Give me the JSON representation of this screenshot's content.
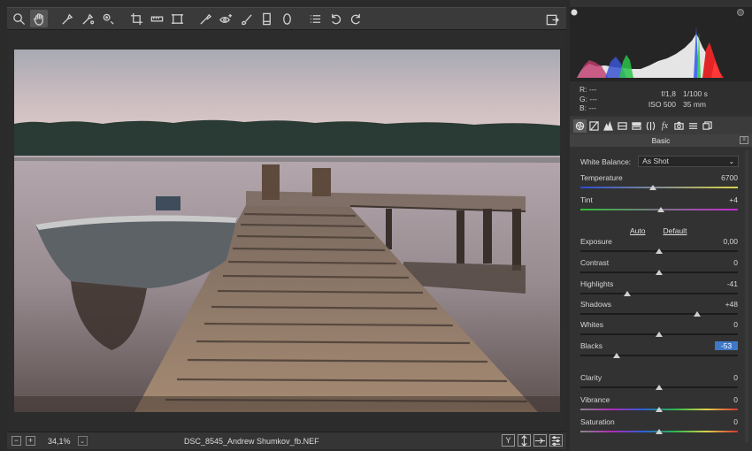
{
  "toolbar": {
    "tools": [
      "zoom-icon",
      "hand-icon",
      "white-balance-icon",
      "color-sampler-icon",
      "target-adjust-icon",
      "crop-icon",
      "straighten-icon",
      "transform-icon",
      "spot-removal-icon",
      "red-eye-icon",
      "adjustment-brush-icon",
      "graduated-filter-icon",
      "radial-filter-icon",
      "presets-list-icon",
      "rotate-ccw-icon",
      "rotate-cw-icon"
    ],
    "active_tool": "hand-icon"
  },
  "status": {
    "zoom": "34,1%",
    "filename": "DSC_8545_Andrew Shumkov_fb.NEF",
    "zoom_minus": "−",
    "zoom_plus": "+",
    "y_label": "Y"
  },
  "readout": {
    "r_label": "R:",
    "r_value": "---",
    "g_label": "G:",
    "g_value": "---",
    "b_label": "B:",
    "b_value": "---",
    "aperture": "f/1,8",
    "shutter": "1/100 s",
    "iso": "ISO 500",
    "focal": "35 mm"
  },
  "panel": {
    "title": "Basic",
    "white_balance_label": "White Balance:",
    "white_balance_value": "As Shot",
    "auto_label": "Auto",
    "default_label": "Default",
    "sliders": [
      {
        "label": "Temperature",
        "value": "6700",
        "level": 0.46
      },
      {
        "label": "Tint",
        "value": "+4",
        "level": 0.51
      },
      {
        "label": "Exposure",
        "value": "0,00",
        "level": 0.5
      },
      {
        "label": "Contrast",
        "value": "0",
        "level": 0.5
      },
      {
        "label": "Highlights",
        "value": "-41",
        "level": 0.3
      },
      {
        "label": "Shadows",
        "value": "+48",
        "level": 0.74
      },
      {
        "label": "Whites",
        "value": "0",
        "level": 0.5
      },
      {
        "label": "Blacks",
        "value": "-53",
        "level": 0.23
      },
      {
        "label": "Clarity",
        "value": "0",
        "level": 0.5
      },
      {
        "label": "Vibrance",
        "value": "0",
        "level": 0.5
      },
      {
        "label": "Saturation",
        "value": "0",
        "level": 0.5
      }
    ]
  },
  "colors": {
    "accent_selection": "#3f78c7"
  }
}
